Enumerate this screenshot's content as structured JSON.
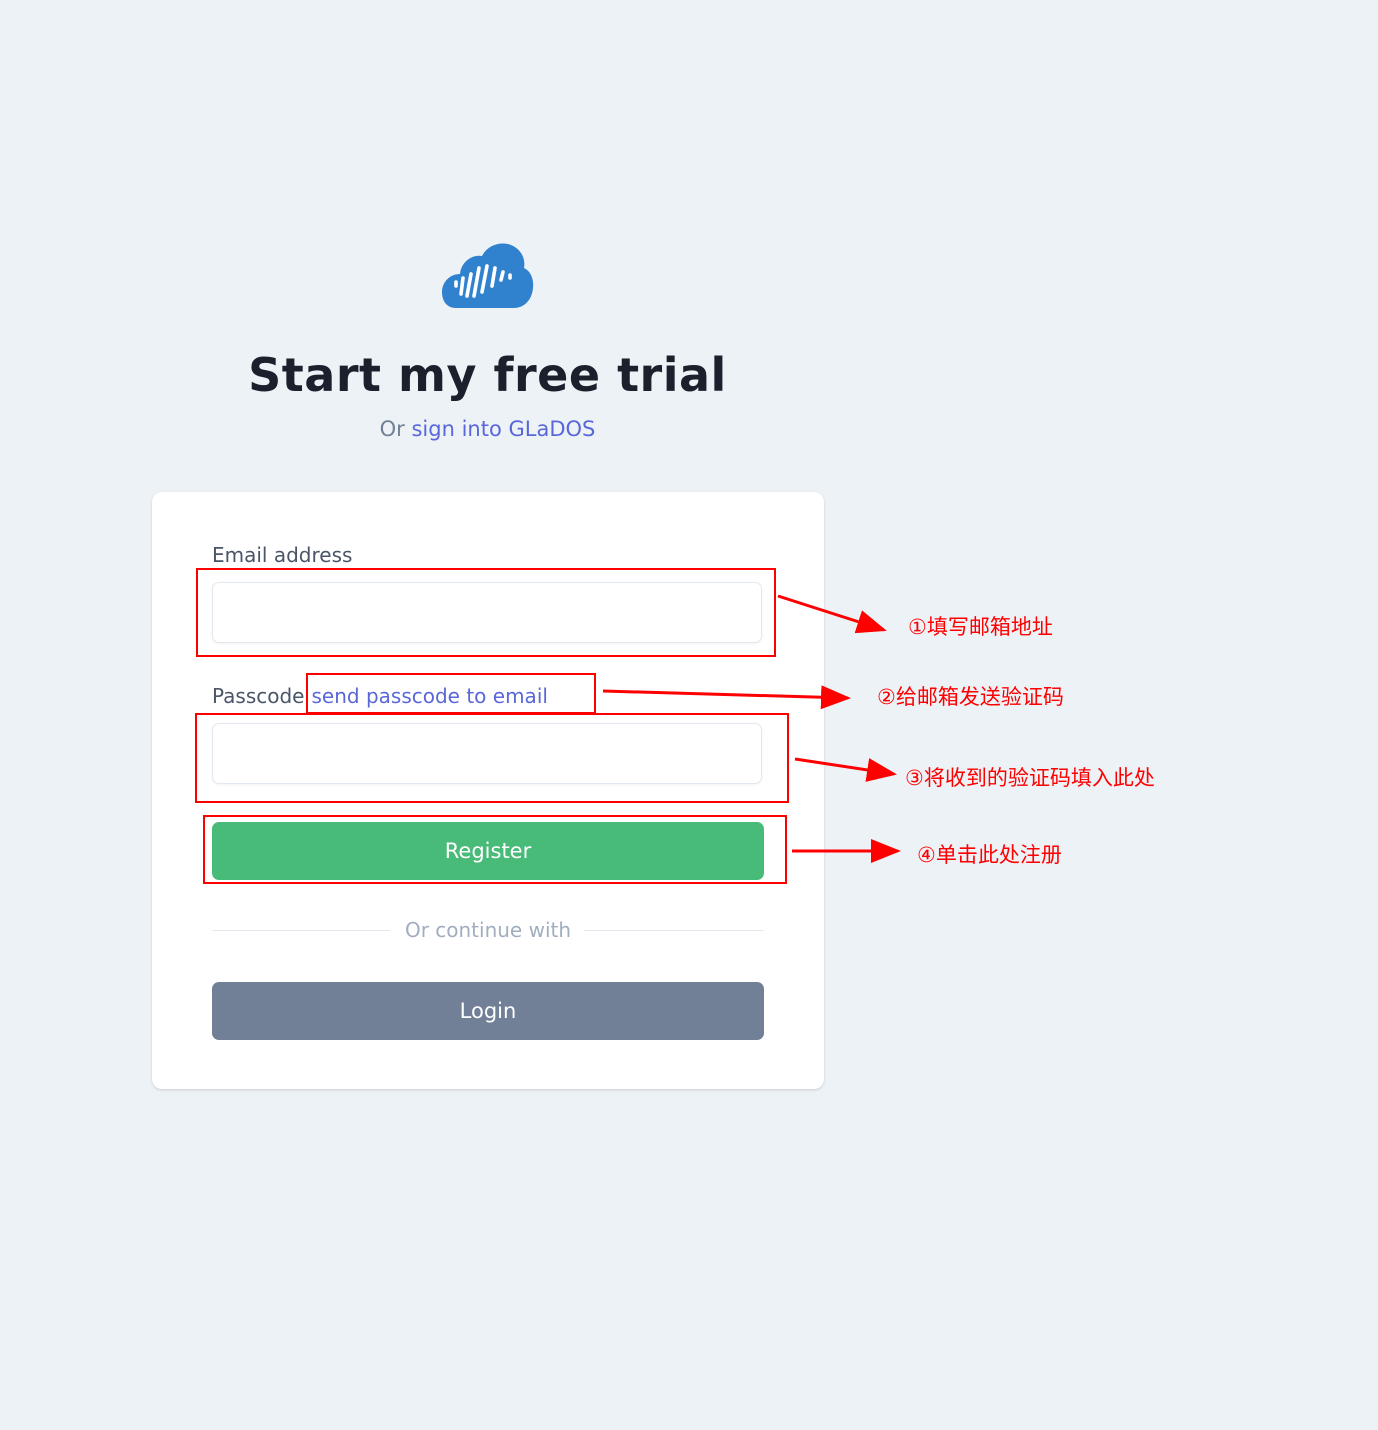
{
  "title": "Start my free trial",
  "subtitle": {
    "prefix": "Or",
    "link": "sign into GLaDOS"
  },
  "form": {
    "email_label": "Email address",
    "email_value": "",
    "passcode_label": "Passcode",
    "send_passcode_link": "send passcode to email",
    "passcode_value": "",
    "register_label": "Register",
    "divider_text": "Or continue with",
    "login_label": "Login"
  },
  "annotations": [
    "①填写邮箱地址",
    "②给邮箱发送验证码",
    "③将收到的验证码填入此处",
    "④单击此处注册"
  ],
  "colors": {
    "background": "#edf2f7",
    "link": "#5a67d8",
    "register": "#48bb78",
    "login": "#718096",
    "logo": "#3182ce",
    "annotation": "#ff0000"
  },
  "icons": {
    "logo": "cloud-soundwave-icon"
  }
}
